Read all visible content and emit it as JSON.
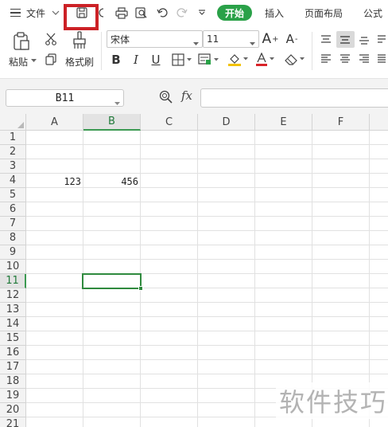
{
  "menubar": {
    "file_label": "文件",
    "tabs": [
      "开始",
      "插入",
      "页面布局",
      "公式"
    ]
  },
  "ribbon": {
    "paste_label": "粘贴",
    "format_painter_label": "格式刷",
    "font_name": "宋体",
    "font_size": "11",
    "bold": "B",
    "italic": "I",
    "underline": "U",
    "grow_font": "A",
    "shrink_font": "A"
  },
  "formula_bar": {
    "name_box": "B11",
    "fx_label": "fx",
    "formula_value": ""
  },
  "sheet": {
    "columns": [
      "A",
      "B",
      "C",
      "D",
      "E",
      "F"
    ],
    "active_column": "B",
    "rows": [
      "1",
      "2",
      "3",
      "4",
      "5",
      "6",
      "7",
      "8",
      "9",
      "10",
      "11",
      "12",
      "13",
      "14",
      "15",
      "16",
      "17",
      "18",
      "19",
      "20",
      "21"
    ],
    "active_row": "11",
    "active_cell": "B11",
    "cells": {
      "A4": "123",
      "B4": "456"
    }
  },
  "watermark": "软件技巧",
  "colors": {
    "accent_green": "#2aa148",
    "selection_green": "#2f8a3e",
    "highlight_red": "#cc2126"
  },
  "icons": {
    "menu": "hamburger-icon",
    "save": "save-icon",
    "print": "print-icon",
    "print_preview": "print-preview-icon",
    "undo": "undo-icon",
    "redo": "redo-icon",
    "paste": "paste-icon",
    "cut": "cut-icon",
    "copy": "copy-icon",
    "format_painter": "format-painter-icon",
    "zoom_formula": "zoom-icon"
  }
}
